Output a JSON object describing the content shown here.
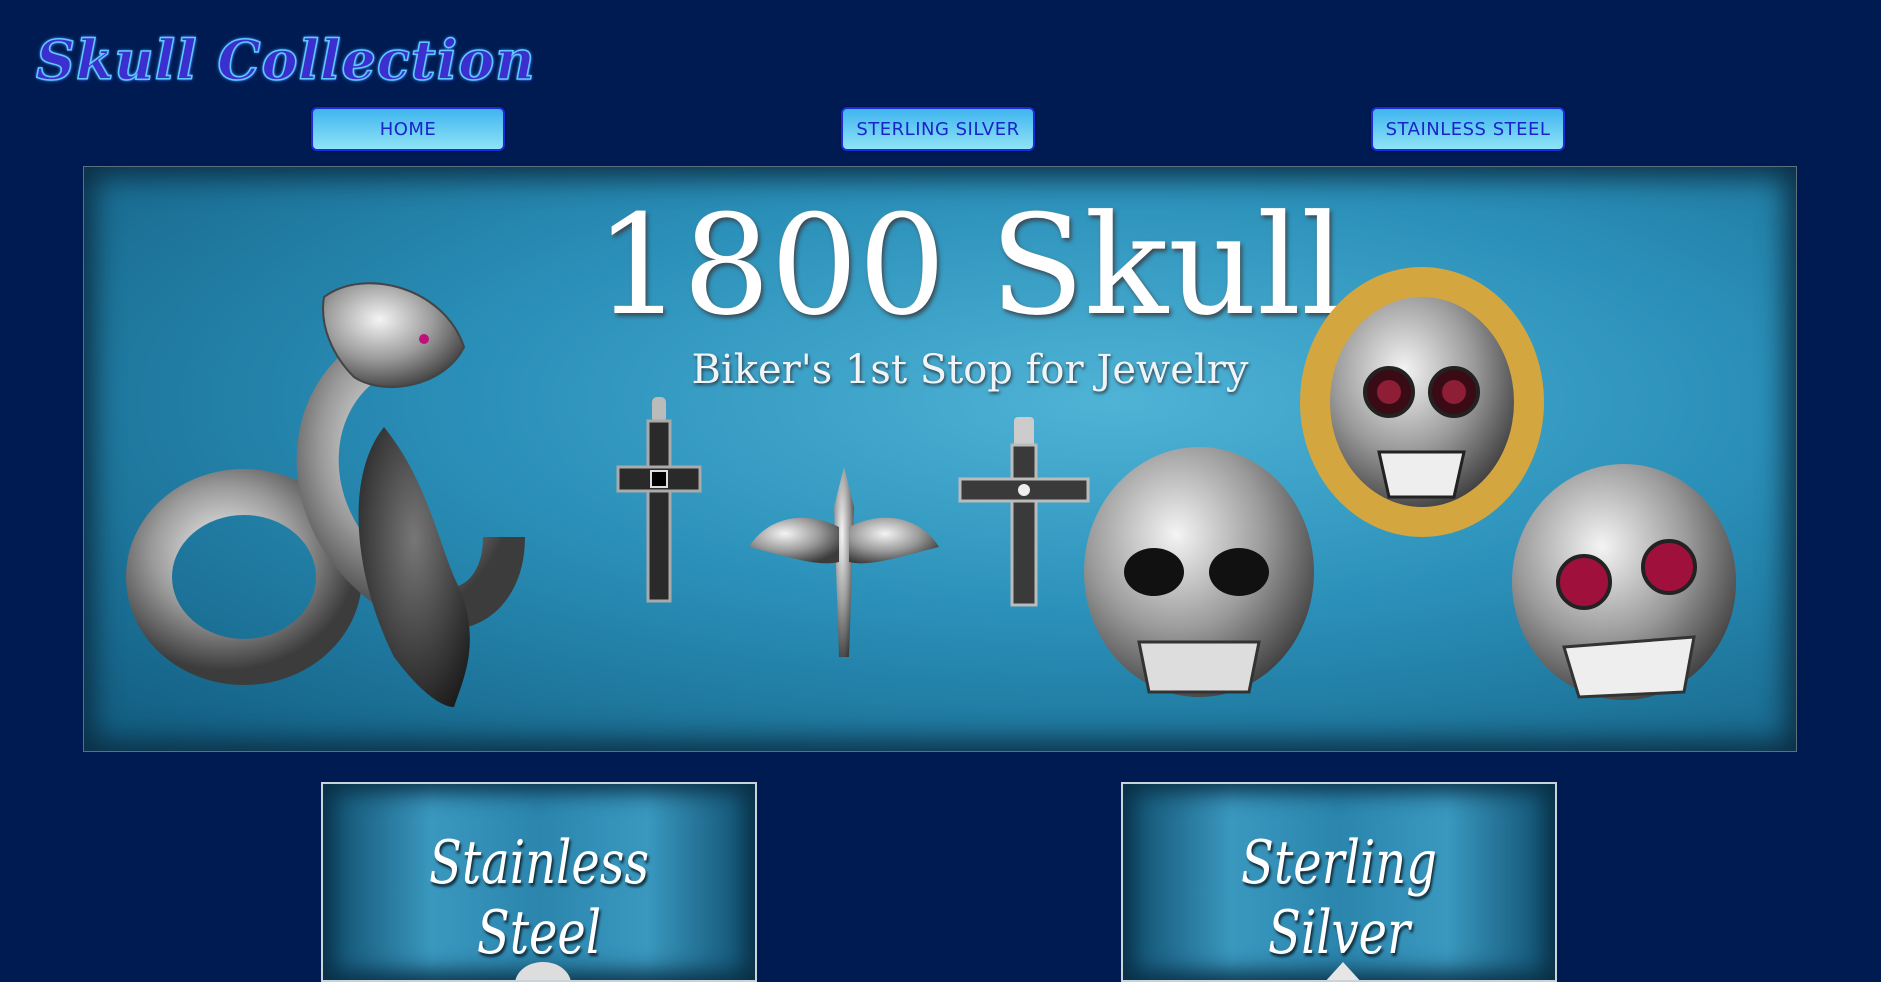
{
  "header": {
    "logo_text": "Skull Collection"
  },
  "nav": {
    "items": [
      {
        "label": "HOME"
      },
      {
        "label": "STERLING SILVER"
      },
      {
        "label": "STAINLESS STEEL"
      }
    ]
  },
  "banner": {
    "title": "1800 Skull",
    "subtitle": "Biker's 1st Stop for Jewelry"
  },
  "categories": [
    {
      "label": "Stainless Steel"
    },
    {
      "label": "Sterling Silver"
    }
  ],
  "colors": {
    "page_background": "#001a52",
    "nav_button_gradient_top": "#3fb5f0",
    "nav_button_text": "#1a25c9",
    "banner_teal": "#2a8fb8"
  }
}
